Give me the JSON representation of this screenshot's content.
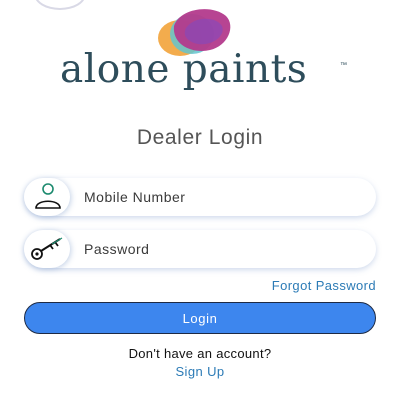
{
  "brand": {
    "name": "alone paints",
    "trademark": "™",
    "colors": {
      "text": "#2e4d5b",
      "orange": "#f2a33a",
      "teal": "#63c4cf",
      "magenta": "#b33a8c",
      "purple": "#7d4bc2"
    }
  },
  "login": {
    "title": "Dealer Login",
    "mobile": {
      "placeholder": "Mobile Number",
      "value": "",
      "icon": "user-icon"
    },
    "password": {
      "placeholder": "Password",
      "value": "",
      "icon": "key-icon"
    },
    "forgot_label": "Forgot Password",
    "submit_label": "Login",
    "no_account_text": "Don't have an account?",
    "signup_label": "Sign Up"
  },
  "theme": {
    "accent": "#3d86ee",
    "link": "#2c7bb6"
  }
}
